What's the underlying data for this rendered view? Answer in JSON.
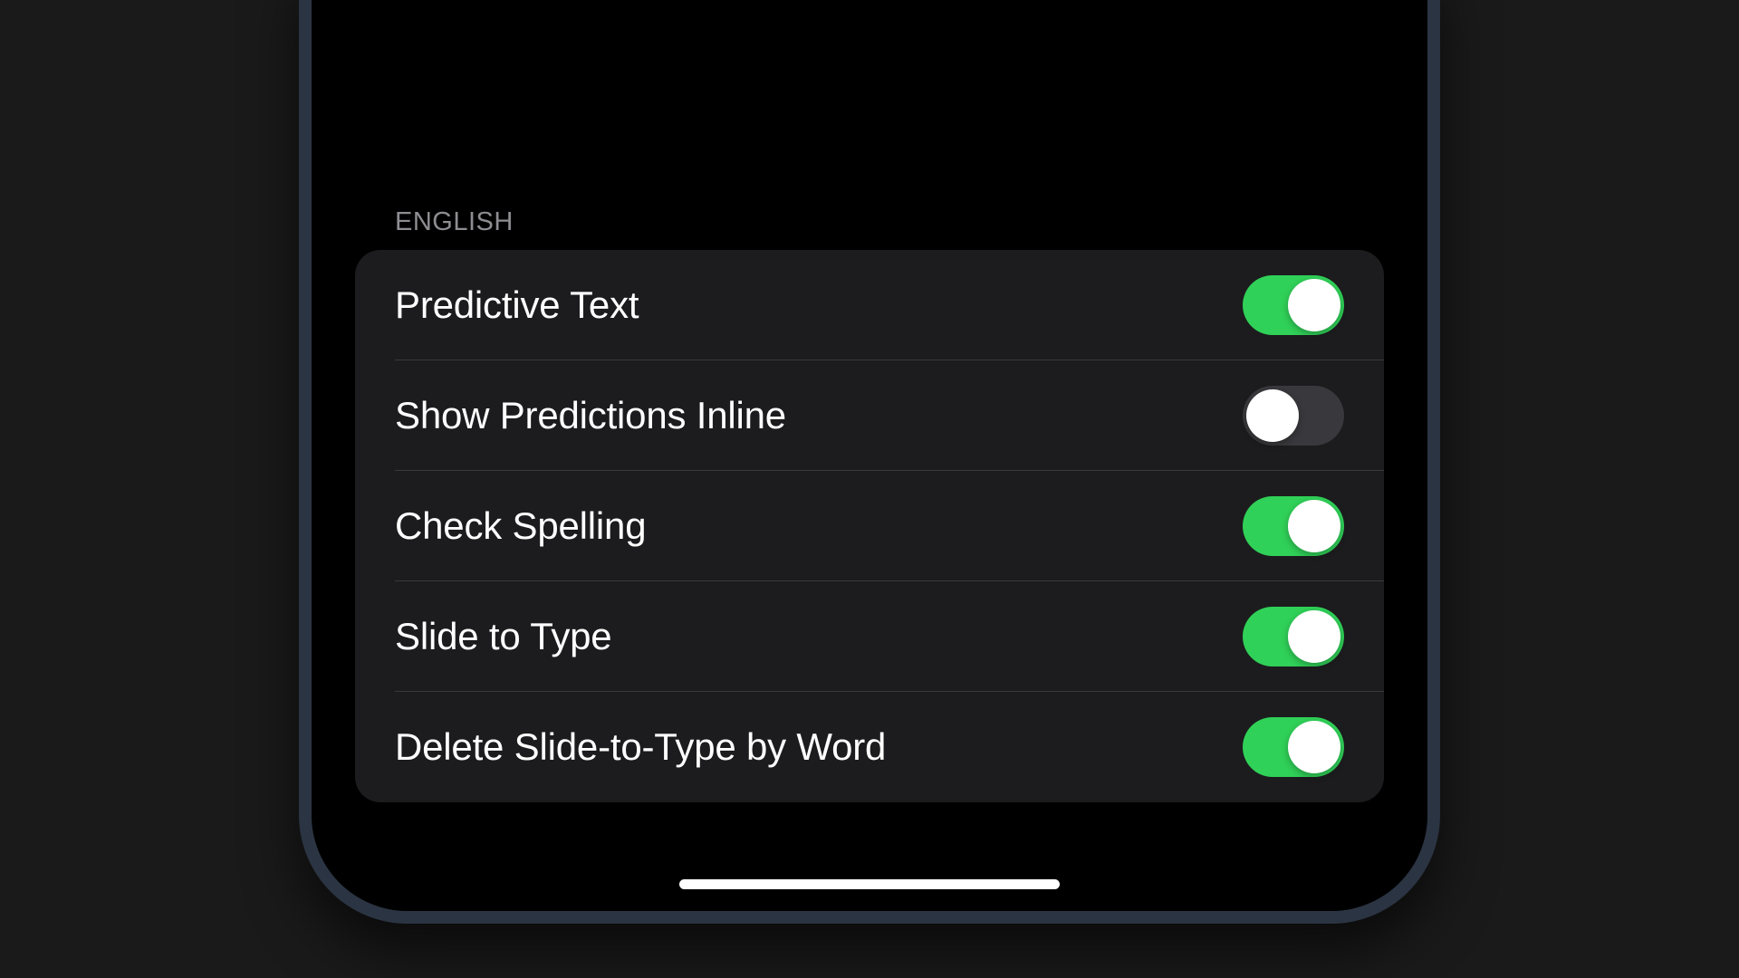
{
  "section": {
    "header": "English",
    "items": [
      {
        "name": "predictive-text",
        "label": "Predictive Text",
        "enabled": true
      },
      {
        "name": "show-predictions-inline",
        "label": "Show Predictions Inline",
        "enabled": false
      },
      {
        "name": "check-spelling",
        "label": "Check Spelling",
        "enabled": true
      },
      {
        "name": "slide-to-type",
        "label": "Slide to Type",
        "enabled": true
      },
      {
        "name": "delete-slide-to-type-word",
        "label": "Delete Slide-to-Type by Word",
        "enabled": true
      }
    ]
  },
  "colors": {
    "toggle_on": "#30d158",
    "toggle_off": "#39393d",
    "group_bg": "#1c1c1e",
    "label": "#ffffff",
    "header": "#8d8d92"
  }
}
